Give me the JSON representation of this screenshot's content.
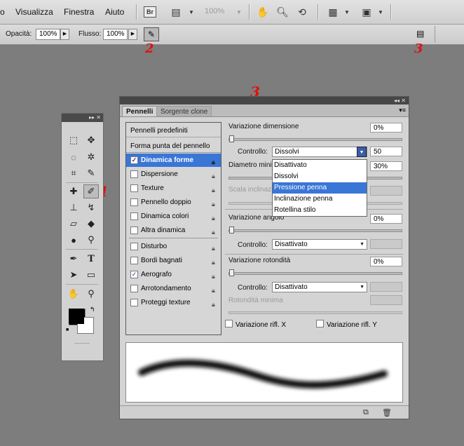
{
  "menubar": {
    "items": [
      "o",
      "Visualizza",
      "Finestra",
      "Aiuto"
    ],
    "br_label": "Br",
    "zoom_label": "100%"
  },
  "options": {
    "opacity_label": "Opacità:",
    "opacity_value": "100%",
    "flow_label": "Flusso:",
    "flow_value": "100%"
  },
  "annotations": {
    "one": "1",
    "two": "2",
    "three": "3"
  },
  "panel": {
    "tab_active": "Pennelli",
    "tab_inactive": "Sorgente clone",
    "sections": [
      "Pennelli predefiniti",
      "Forma punta del pennello"
    ],
    "items": [
      {
        "label": "Dinamica forme",
        "checked": true,
        "selected": true
      },
      {
        "label": "Dispersione",
        "checked": false
      },
      {
        "label": "Texture",
        "checked": false
      },
      {
        "label": "Pennello doppio",
        "checked": false
      },
      {
        "label": "Dinamica colori",
        "checked": false
      },
      {
        "label": "Altra dinamica",
        "checked": false
      },
      {
        "label": "Disturbo",
        "checked": false
      },
      {
        "label": "Bordi bagnati",
        "checked": false
      },
      {
        "label": "Aerografo",
        "checked": true
      },
      {
        "label": "Arrotondamento",
        "checked": false
      },
      {
        "label": "Proteggi texture",
        "checked": false
      }
    ],
    "check_mark": "✓",
    "right": {
      "size_jitter_label": "Variazione dimensione",
      "size_jitter_value": "0%",
      "control_label": "Controllo:",
      "control_value_open": "Dissolvi",
      "control_steps": "50",
      "min_diameter_label": "Diametro minimo",
      "min_diameter_value": "30%",
      "tilt_scale_label": "Scala inclinazione",
      "angle_jitter_label": "Variazione angolo",
      "angle_jitter_value": "0%",
      "angle_control_value": "Disattivato",
      "roundness_jitter_label": "Variazione rotondità",
      "roundness_jitter_value": "0%",
      "roundness_control_value": "Disattivato",
      "min_roundness_label": "Rotondità minima",
      "flip_x_label": "Variazione rifl. X",
      "flip_y_label": "Variazione rifl. Y"
    },
    "dropdown_options": [
      "Disattivato",
      "Dissolvi",
      "Pressione penna",
      "Inclinazione penna",
      "Rotellina stilo"
    ],
    "dropdown_highlight": "Pressione penna"
  },
  "colors": {
    "accent": "#3a76d6",
    "annotation": "#e01010"
  }
}
